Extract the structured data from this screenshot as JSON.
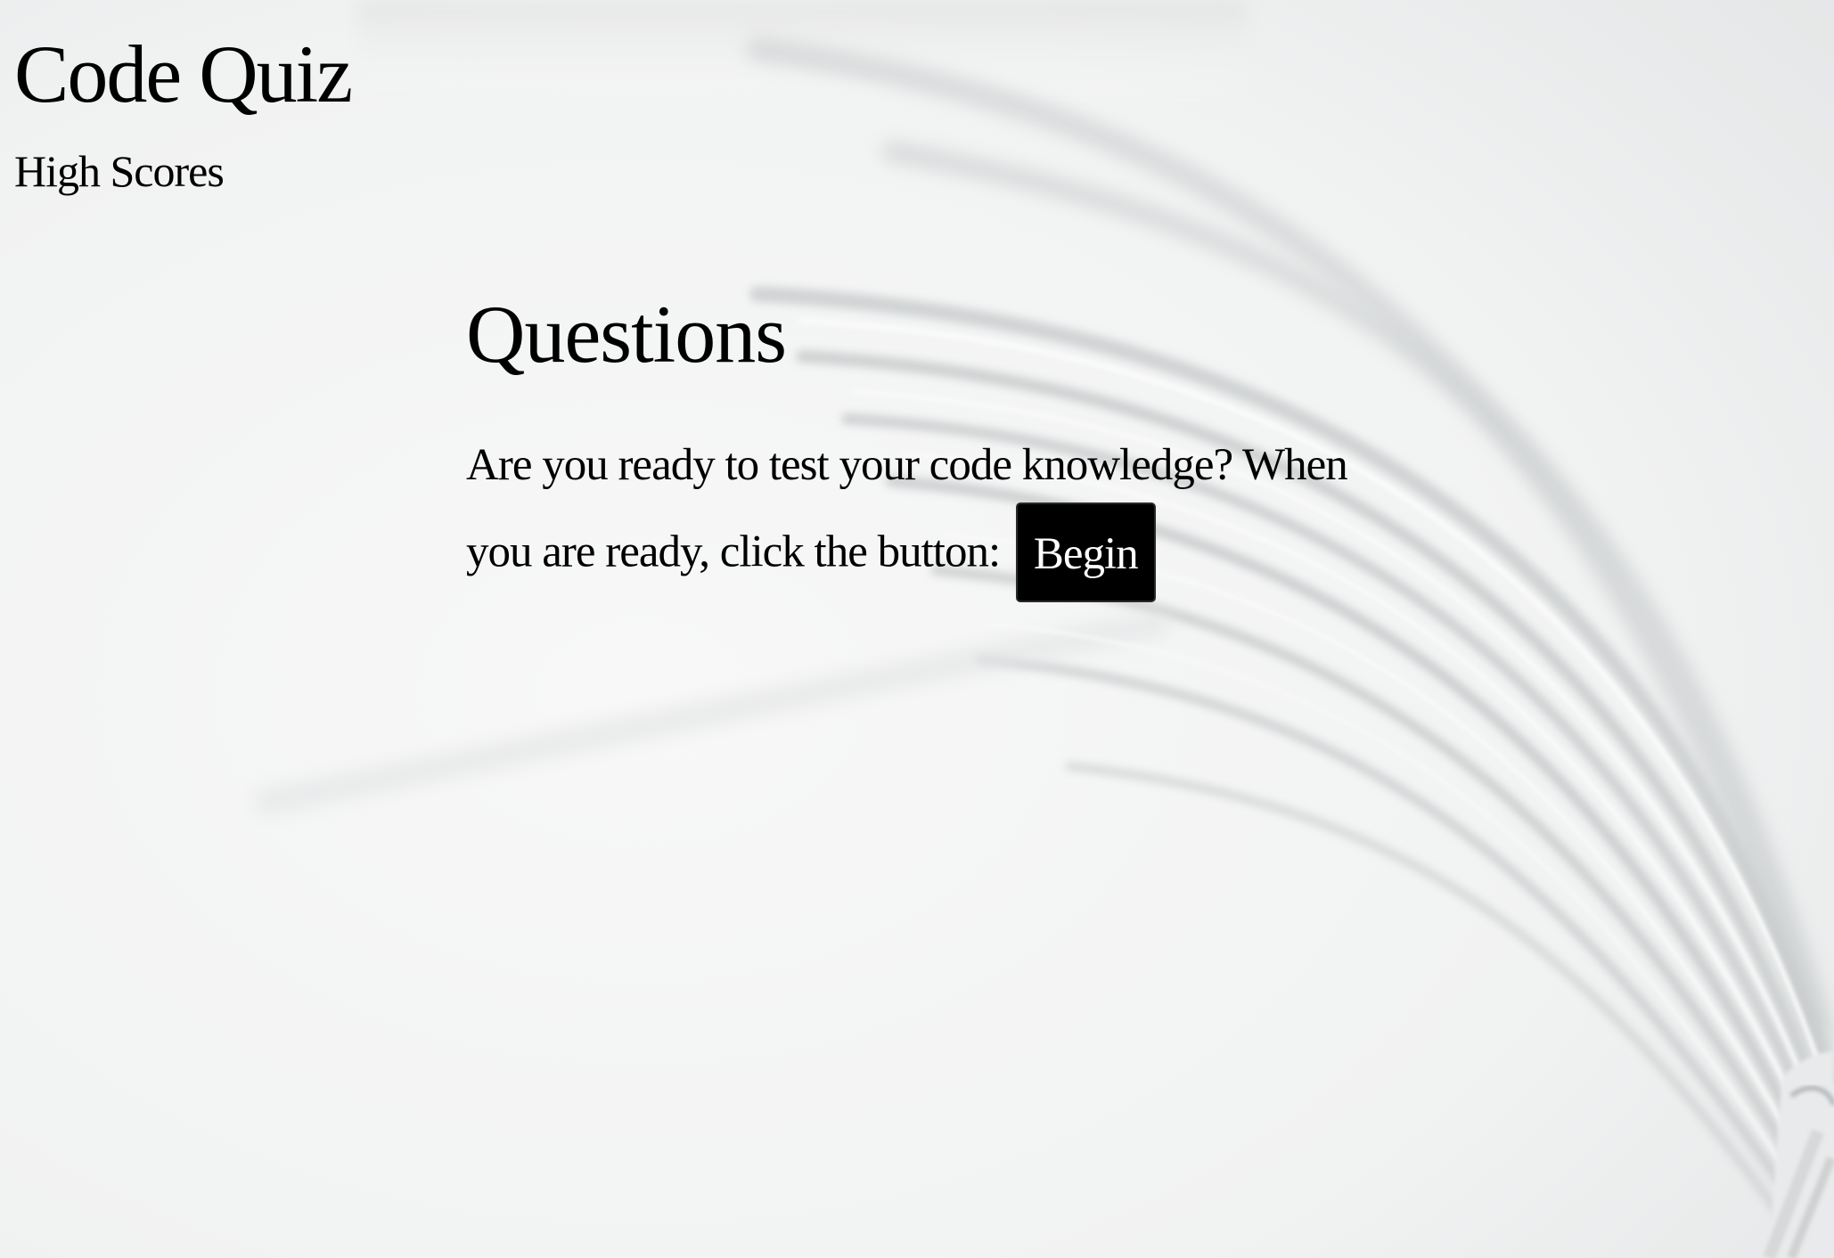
{
  "header": {
    "title": "Code Quiz",
    "high_scores_link": "High Scores"
  },
  "main": {
    "heading": "Questions",
    "intro_text": "Are you ready to test your code knowledge? When you are ready, click the button:",
    "begin_button": "Begin"
  },
  "colors": {
    "text": "#000000",
    "button_bg": "#000000",
    "button_text": "#ffffff",
    "background": "#f3f4f4"
  }
}
